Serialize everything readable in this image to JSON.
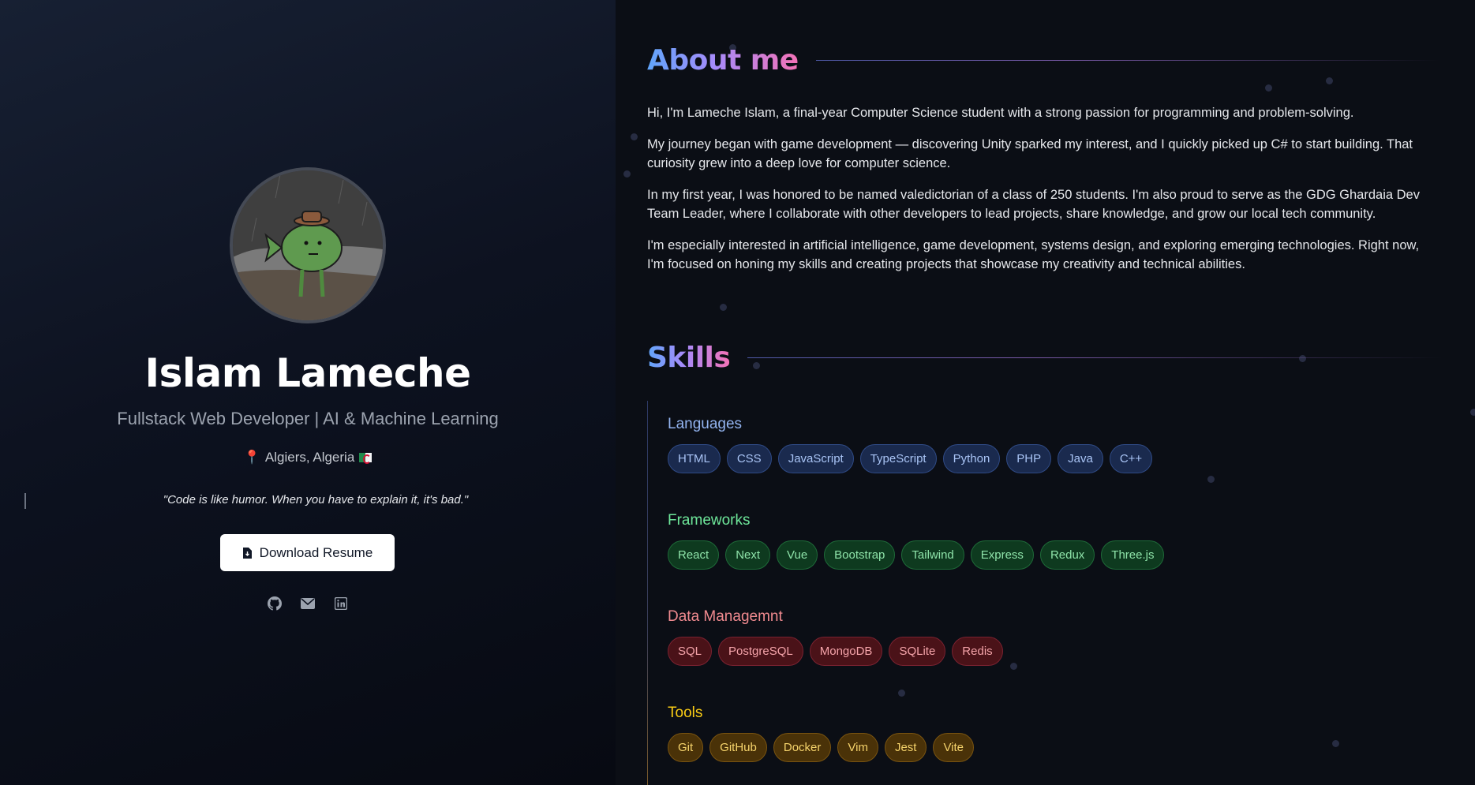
{
  "profile": {
    "name": "Islam Lameche",
    "title": "Fullstack Web Developer | AI & Machine Learning",
    "location": "Algiers, Algeria",
    "quote": "\"Code is like humor. When you have to explain it, it's bad.\"",
    "download_label": "Download Resume",
    "socials": [
      "github-icon",
      "mail-icon",
      "linkedin-icon"
    ]
  },
  "about": {
    "heading": "About me",
    "paragraphs": [
      "Hi, I'm Lameche Islam, a final-year Computer Science student with a strong passion for programming and problem-solving.",
      "My journey began with game development — discovering Unity sparked my interest, and I quickly picked up C# to start building. That curiosity grew into a deep love for computer science.",
      "In my first year, I was honored to be named valedictorian of a class of 250 students. I'm also proud to serve as the GDG Ghardaia Dev Team Leader, where I collaborate with other developers to lead projects, share knowledge, and grow our local tech community.",
      "I'm especially interested in artificial intelligence, game development, systems design, and exploring emerging technologies. Right now, I'm focused on honing my skills and creating projects that showcase my creativity and technical abilities."
    ]
  },
  "skills": {
    "heading": "Skills",
    "groups": [
      {
        "title": "Languages",
        "color": "#93b4f0",
        "items": [
          "HTML",
          "CSS",
          "JavaScript",
          "TypeScript",
          "Python",
          "PHP",
          "Java",
          "C++"
        ]
      },
      {
        "title": "Frameworks",
        "color": "#6ee79a",
        "items": [
          "React",
          "Next",
          "Vue",
          "Bootstrap",
          "Tailwind",
          "Express",
          "Redux",
          "Three.js"
        ]
      },
      {
        "title": "Data Managemnt",
        "color": "#f08a8f",
        "items": [
          "SQL",
          "PostgreSQL",
          "MongoDB",
          "SQLite",
          "Redis"
        ]
      },
      {
        "title": "Tools",
        "color": "#facc15",
        "items": [
          "Git",
          "GitHub",
          "Docker",
          "Vim",
          "Jest",
          "Vite"
        ]
      }
    ]
  }
}
